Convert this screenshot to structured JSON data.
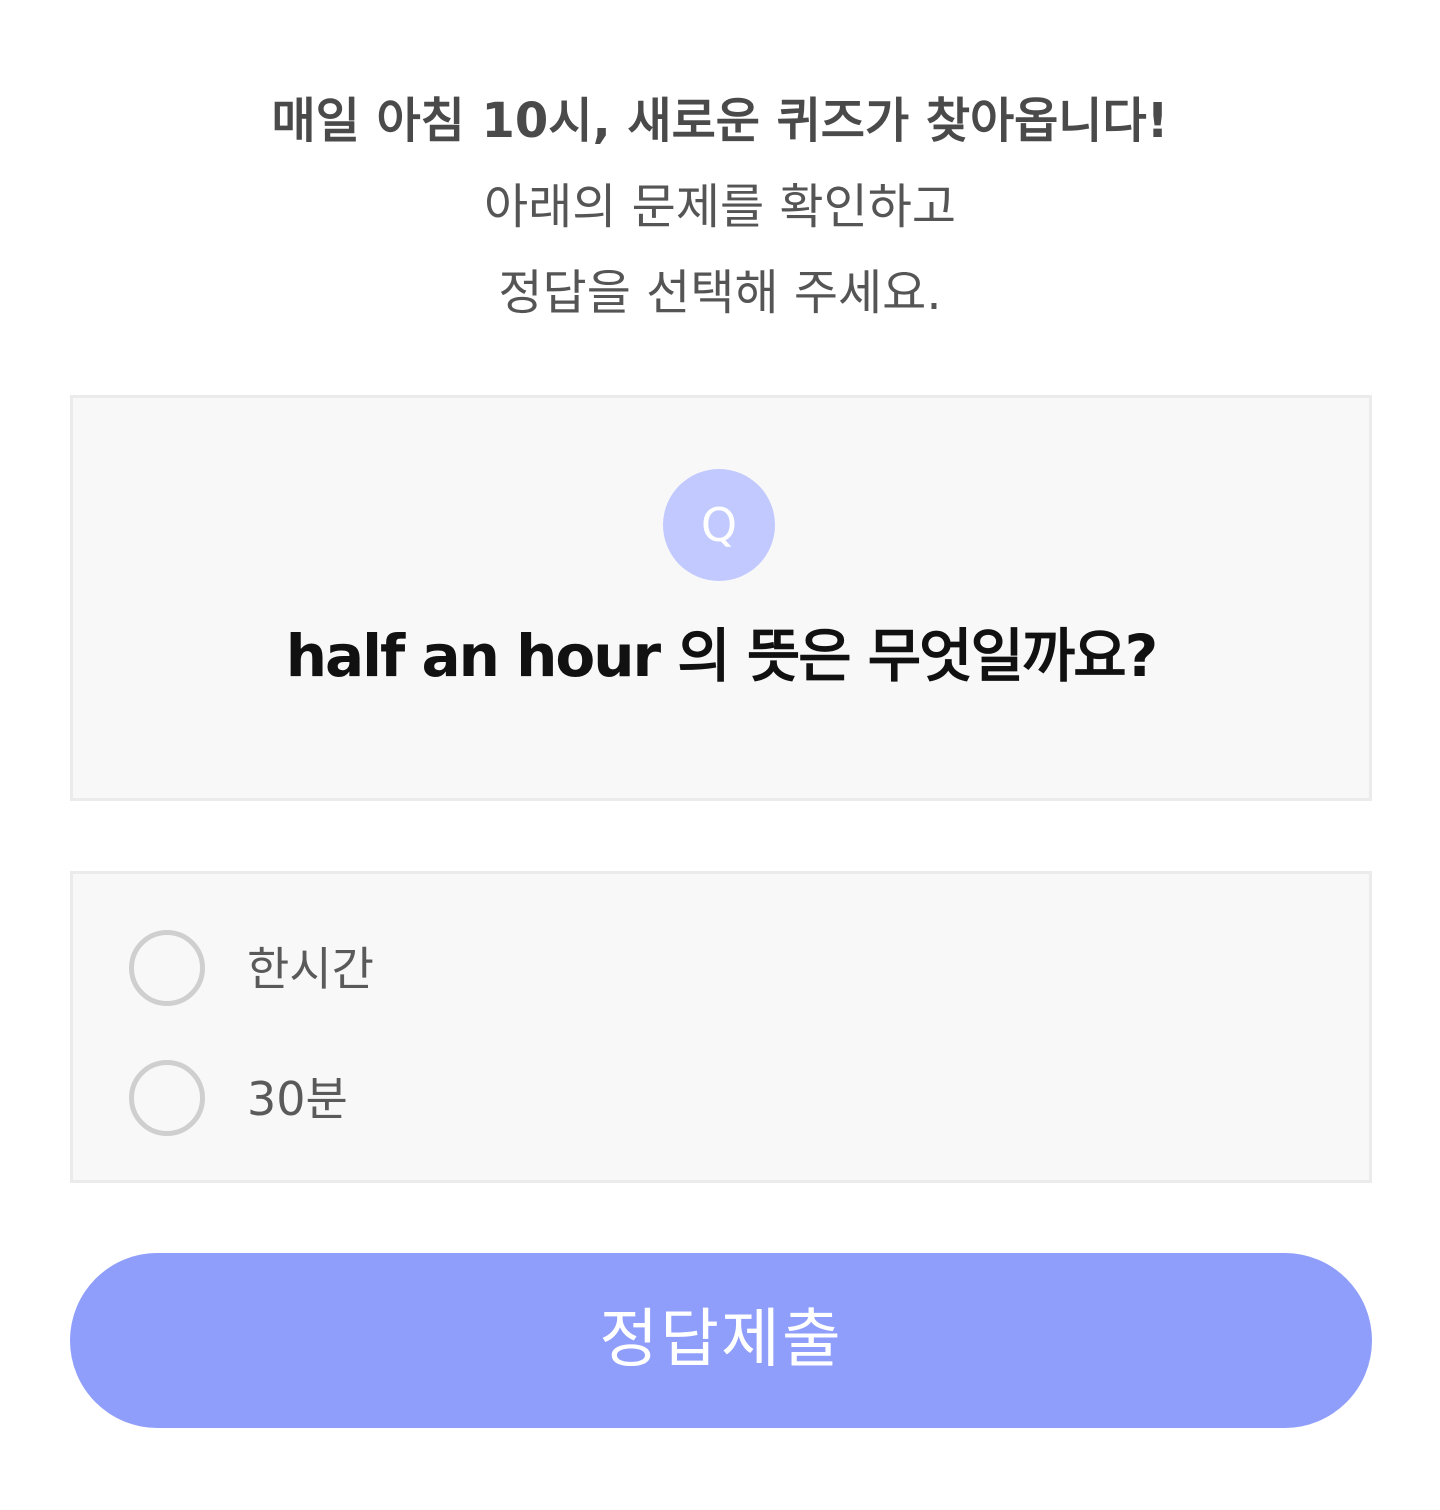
{
  "intro": {
    "line1": "매일 아침 10시, 새로운 퀴즈가 찾아옵니다!",
    "line2": "아래의 문제를 확인하고",
    "line3": "정답을 선택해 주세요."
  },
  "question": {
    "badge": "Q",
    "text": "half an hour 의 뜻은 무엇일까요?"
  },
  "options": [
    {
      "label": "한시간",
      "selected": false
    },
    {
      "label": "30분",
      "selected": false
    }
  ],
  "submit": {
    "label": "정답제출"
  },
  "colors": {
    "accent": "#8f9dfb",
    "badge": "#c2c9ff",
    "card_bg": "#f8f8f8",
    "card_border": "#ebebeb"
  }
}
